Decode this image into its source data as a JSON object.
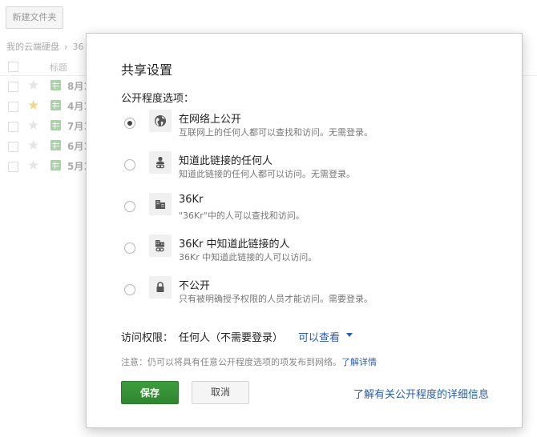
{
  "background": {
    "new_folder_label": "新建文件夹",
    "breadcrumb": {
      "root": "我的云端硬盘",
      "separator": "›",
      "current": "36"
    },
    "list_header_title": "标题",
    "rows": [
      {
        "name": "8月1",
        "starred": false
      },
      {
        "name": "4月1",
        "starred": true
      },
      {
        "name": "7月1",
        "starred": false
      },
      {
        "name": "6月1",
        "starred": false
      },
      {
        "name": "5月1",
        "starred": false
      }
    ]
  },
  "dialog": {
    "title": "共享设置",
    "visibility_label": "公开程度选项：",
    "options": [
      {
        "title": "在网络上公开",
        "desc": "互联网上的任何人都可以查找和访问。无需登录。",
        "icon": "globe-icon",
        "selected": true
      },
      {
        "title": "知道此链接的任何人",
        "desc": "知道此链接的任何人都可以访问。无需登录。",
        "icon": "person-link-icon",
        "selected": false
      },
      {
        "title": "36Kr",
        "desc": "\"36Kr\"中的人可以查找和访问。",
        "icon": "building-icon",
        "selected": false
      },
      {
        "title": "36Kr 中知道此链接的人",
        "desc": "36Kr 中知道此链接的人可以访问。",
        "icon": "building-link-icon",
        "selected": false
      },
      {
        "title": "不公开",
        "desc": "只有被明确授予权限的人员才能访问。需要登录。",
        "icon": "lock-icon",
        "selected": false
      }
    ],
    "access": {
      "label": "访问权限：",
      "value": "任何人（不需要登录）",
      "permission": "可以查看"
    },
    "note": {
      "text": "注意：仍可以将具有任意公开程度选项的项发布到网络。",
      "link": "了解详情"
    },
    "save_label": "保存",
    "cancel_label": "取消",
    "learn_more_label": "了解有关公开程度的详细信息"
  },
  "colors": {
    "link": "#2a5db0",
    "save_button": "#3d9d3d"
  }
}
